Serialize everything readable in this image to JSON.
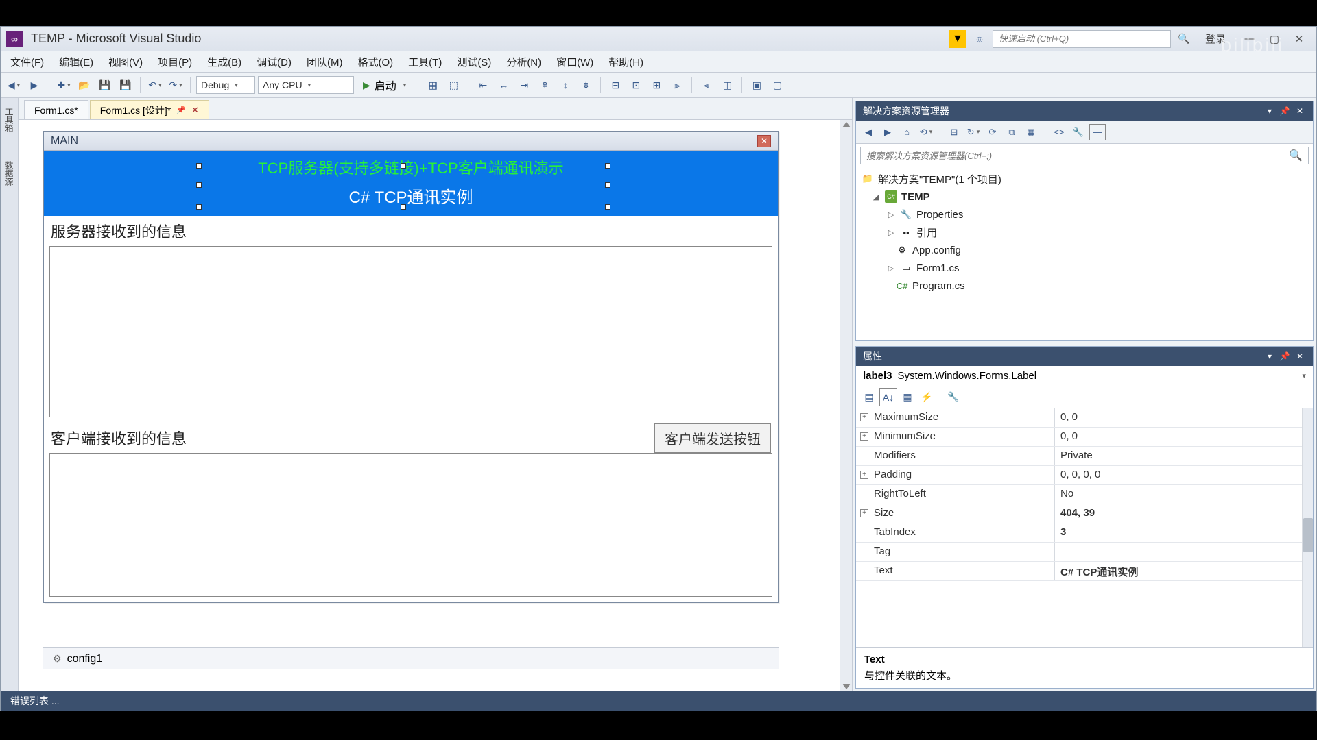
{
  "title": "TEMP - Microsoft Visual Studio",
  "quick_launch_placeholder": "快速启动 (Ctrl+Q)",
  "login": "登录",
  "menu": [
    "文件(F)",
    "编辑(E)",
    "视图(V)",
    "项目(P)",
    "生成(B)",
    "调试(D)",
    "团队(M)",
    "格式(O)",
    "工具(T)",
    "测试(S)",
    "分析(N)",
    "窗口(W)",
    "帮助(H)"
  ],
  "config_combo": "Debug",
  "platform_combo": "Any CPU",
  "start_label": "启动",
  "tabs": [
    {
      "label": "Form1.cs*",
      "active": false
    },
    {
      "label": "Form1.cs [设计]*",
      "active": true
    }
  ],
  "form": {
    "title": "MAIN",
    "label_green": "TCP服务器(支持多链接)+TCP客户端通讯演示",
    "label_white": "C# TCP通讯实例",
    "server_recv": "服务器接收到的信息",
    "client_recv": "客户端接收到的信息",
    "send_btn": "客户端发送按钮"
  },
  "tray_item": "config1",
  "status": "错误列表 ...",
  "solution_explorer": {
    "title": "解决方案资源管理器",
    "search_placeholder": "搜索解决方案资源管理器(Ctrl+;)",
    "root": "解决方案\"TEMP\"(1 个项目)",
    "project": "TEMP",
    "nodes": [
      "Properties",
      "引用",
      "App.config",
      "Form1.cs",
      "Program.cs"
    ]
  },
  "properties": {
    "title": "属性",
    "object_name": "label3",
    "object_type": "System.Windows.Forms.Label",
    "rows": [
      {
        "name": "MaximumSize",
        "value": "0, 0",
        "exp": true
      },
      {
        "name": "MinimumSize",
        "value": "0, 0",
        "exp": true
      },
      {
        "name": "Modifiers",
        "value": "Private"
      },
      {
        "name": "Padding",
        "value": "0, 0, 0, 0",
        "exp": true
      },
      {
        "name": "RightToLeft",
        "value": "No"
      },
      {
        "name": "Size",
        "value": "404, 39",
        "exp": true,
        "bold": true
      },
      {
        "name": "TabIndex",
        "value": "3",
        "bold": true
      },
      {
        "name": "Tag",
        "value": ""
      },
      {
        "name": "Text",
        "value": "C# TCP通讯实例",
        "bold": true
      }
    ],
    "desc_title": "Text",
    "desc_body": "与控件关联的文本。"
  },
  "watermark": "bilibili"
}
